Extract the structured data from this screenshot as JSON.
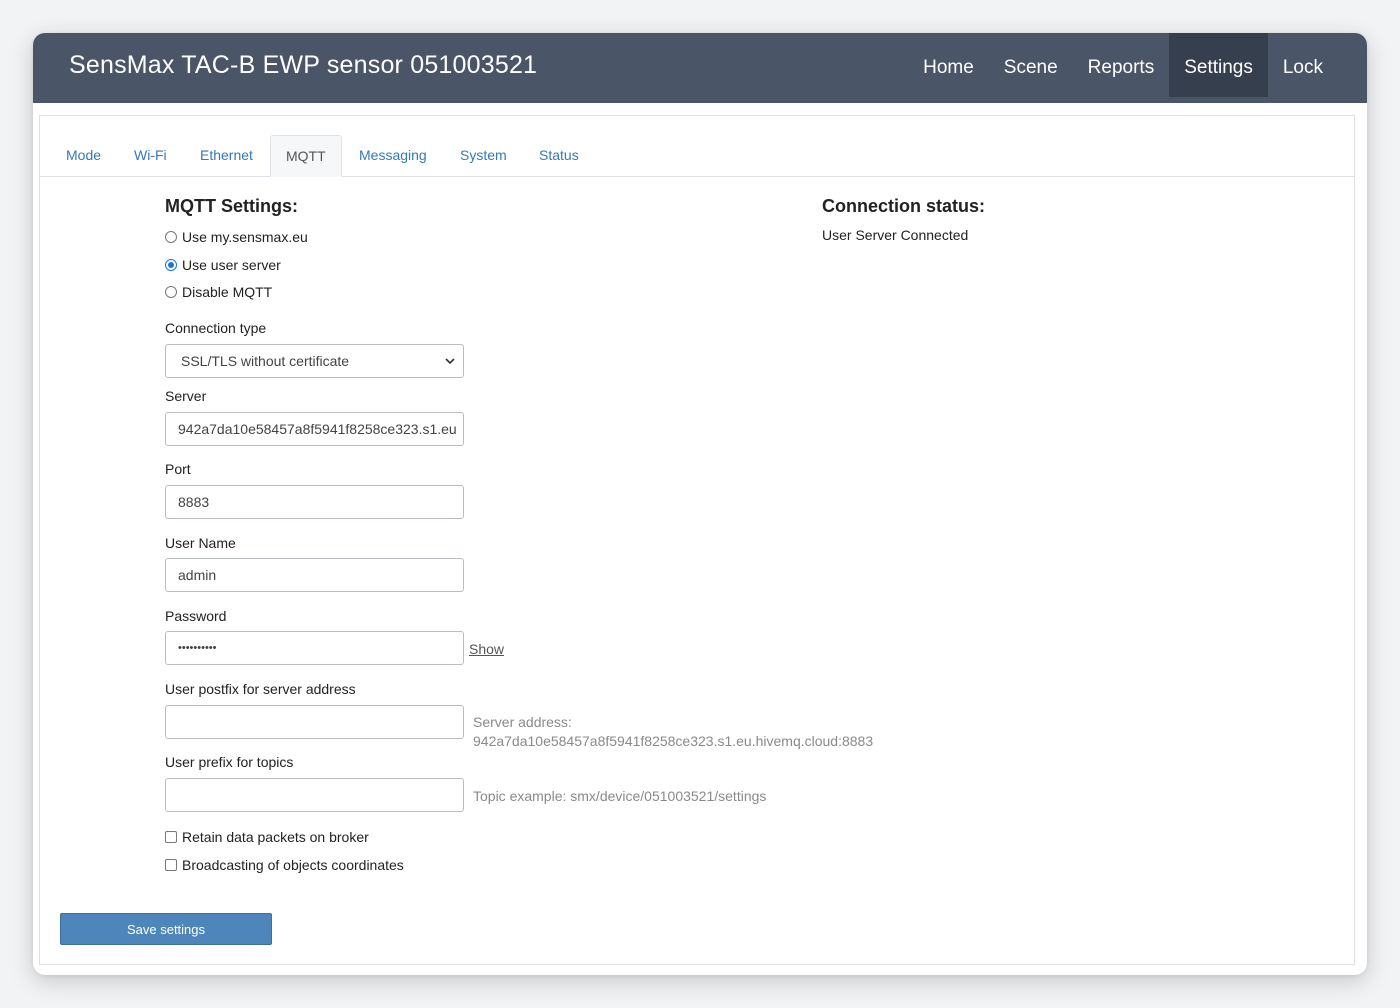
{
  "app": {
    "title": "SensMax TAC-B EWP sensor 051003521"
  },
  "nav": [
    {
      "label": "Home",
      "active": false
    },
    {
      "label": "Scene",
      "active": false
    },
    {
      "label": "Reports",
      "active": false
    },
    {
      "label": "Settings",
      "active": true
    },
    {
      "label": "Lock",
      "active": false
    }
  ],
  "tabs": [
    {
      "label": "Mode"
    },
    {
      "label": "Wi-Fi"
    },
    {
      "label": "Ethernet"
    },
    {
      "label": "MQTT"
    },
    {
      "label": "Messaging"
    },
    {
      "label": "System"
    },
    {
      "label": "Status"
    }
  ],
  "active_tab": "MQTT",
  "mqtt": {
    "heading": "MQTT Settings:",
    "options": [
      {
        "label": "Use my.sensmax.eu",
        "checked": false
      },
      {
        "label": "Use user server",
        "checked": true
      },
      {
        "label": "Disable MQTT",
        "checked": false
      }
    ],
    "connection_type": {
      "label": "Connection type",
      "value": "SSL/TLS without certificate"
    },
    "server": {
      "label": "Server",
      "value": "942a7da10e58457a8f5941f8258ce323.s1.eu"
    },
    "port": {
      "label": "Port",
      "value": "8883"
    },
    "username": {
      "label": "User Name",
      "value": "admin"
    },
    "password": {
      "label": "Password",
      "value": "••••••••••",
      "show_label": "Show"
    },
    "postfix": {
      "label": "User postfix for server address",
      "value": "",
      "hint_title": "Server address:",
      "hint_value": "942a7da10e58457a8f5941f8258ce323.s1.eu.hivemq.cloud:8883"
    },
    "prefix": {
      "label": "User prefix for topics",
      "value": "",
      "hint": "Topic example: smx/device/051003521/settings"
    },
    "retain": {
      "label": "Retain data packets on broker",
      "checked": false
    },
    "broadcast": {
      "label": "Broadcasting of objects coordinates",
      "checked": false
    }
  },
  "status": {
    "heading": "Connection status:",
    "text": "User Server Connected"
  },
  "save_button": "Save settings",
  "colors": {
    "topbar": "#4a5568",
    "active_nav": "#363f4d",
    "link": "#337ab7",
    "button": "#4e86bb"
  }
}
